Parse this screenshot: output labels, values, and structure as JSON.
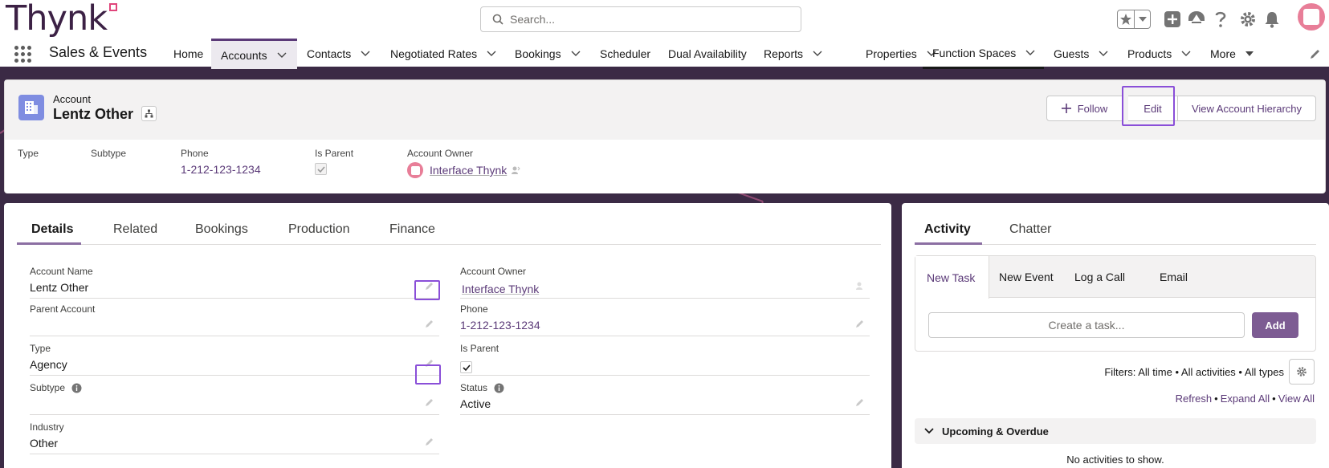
{
  "header": {
    "logo_text": "Thynk",
    "search_placeholder": "Search..."
  },
  "nav": {
    "app_name": "Sales & Events",
    "items": [
      {
        "label": "Home",
        "has_menu": false
      },
      {
        "label": "Accounts",
        "has_menu": true
      },
      {
        "label": "Contacts",
        "has_menu": true
      },
      {
        "label": "Negotiated Rates",
        "has_menu": true
      },
      {
        "label": "Bookings",
        "has_menu": true
      },
      {
        "label": "Scheduler",
        "has_menu": false
      },
      {
        "label": "Dual Availability",
        "has_menu": false
      },
      {
        "label": "Reports",
        "has_menu": true
      },
      {
        "label": "Properties",
        "has_menu": true
      },
      {
        "label": "Function Spaces",
        "has_menu": true
      },
      {
        "label": "Guests",
        "has_menu": true
      },
      {
        "label": "Products",
        "has_menu": true
      },
      {
        "label": "More",
        "has_menu": true
      }
    ]
  },
  "record": {
    "object_label": "Account",
    "name": "Lentz Other",
    "actions": {
      "follow": "Follow",
      "edit": "Edit",
      "view_hierarchy": "View Account Hierarchy"
    },
    "highlights": {
      "type_label": "Type",
      "subtype_label": "Subtype",
      "phone_label": "Phone",
      "phone_value": "1-212-123-1234",
      "is_parent_label": "Is Parent",
      "owner_label": "Account Owner",
      "owner_value": "Interface Thynk"
    }
  },
  "details": {
    "tabs": [
      "Details",
      "Related",
      "Bookings",
      "Production",
      "Finance"
    ],
    "fields": {
      "account_name": {
        "label": "Account Name",
        "value": "Lentz Other"
      },
      "account_owner": {
        "label": "Account Owner",
        "value": "Interface Thynk"
      },
      "parent_account": {
        "label": "Parent Account",
        "value": ""
      },
      "phone": {
        "label": "Phone",
        "value": "1-212-123-1234"
      },
      "type": {
        "label": "Type",
        "value": "Agency"
      },
      "is_parent": {
        "label": "Is Parent",
        "checked": true
      },
      "subtype": {
        "label": "Subtype",
        "value": ""
      },
      "status": {
        "label": "Status",
        "value": "Active"
      },
      "industry": {
        "label": "Industry",
        "value": "Other"
      }
    }
  },
  "activity": {
    "tabs": [
      "Activity",
      "Chatter"
    ],
    "publisher_tabs": [
      "New Task",
      "New Event",
      "Log a Call",
      "Email"
    ],
    "task_placeholder": "Create a task...",
    "add_label": "Add",
    "filters_text": "Filters: All time • All activities • All types",
    "links": {
      "refresh": "Refresh",
      "expand_all": "Expand All",
      "view_all": "View All"
    },
    "upcoming_label": "Upcoming & Overdue",
    "empty_text": "No activities to show."
  },
  "colors": {
    "brand": "#3c2145",
    "accent": "#5b3a78",
    "logo_mark": "#e0457b",
    "highlight_box": "#8a4fd8",
    "add_button": "#7d5c93",
    "account_icon": "#7f8de1"
  }
}
